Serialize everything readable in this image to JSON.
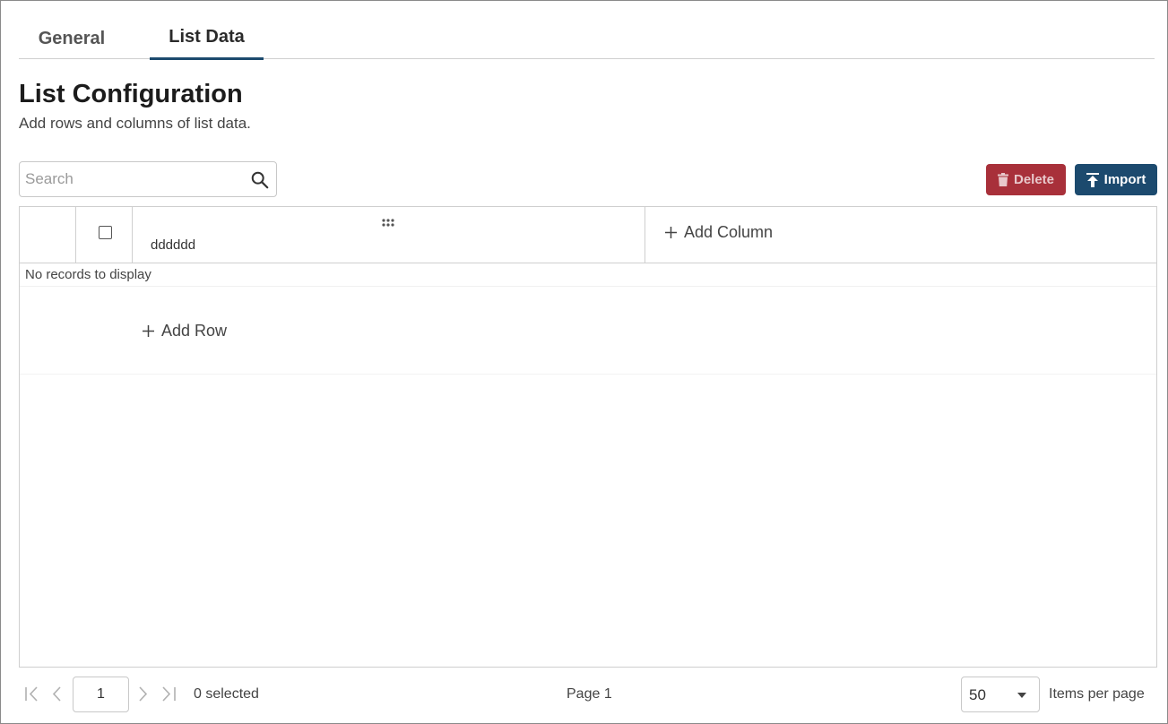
{
  "tabs": [
    {
      "label": "General",
      "active": false
    },
    {
      "label": "List Data",
      "active": true
    }
  ],
  "header": {
    "title": "List Configuration",
    "subtitle": "Add rows and columns of list data."
  },
  "toolbar": {
    "search_placeholder": "Search",
    "delete_label": "Delete",
    "import_label": "Import"
  },
  "grid": {
    "columns": [
      "dddddd"
    ],
    "add_column_label": "Add Column",
    "empty_message": "No records to display",
    "add_row_label": "Add Row"
  },
  "pager": {
    "current_page": "1",
    "selected_text": "0 selected",
    "page_text": "Page 1",
    "items_per_page": "50",
    "items_per_page_label": "Items per page"
  },
  "colors": {
    "accent": "#1c4a6e",
    "danger": "#a8303a"
  },
  "icons": [
    "search-icon",
    "trash-icon",
    "upload-icon",
    "drag-dots-icon",
    "plus-icon",
    "first-page-icon",
    "prev-page-icon",
    "next-page-icon",
    "last-page-icon",
    "caret-down-icon"
  ]
}
